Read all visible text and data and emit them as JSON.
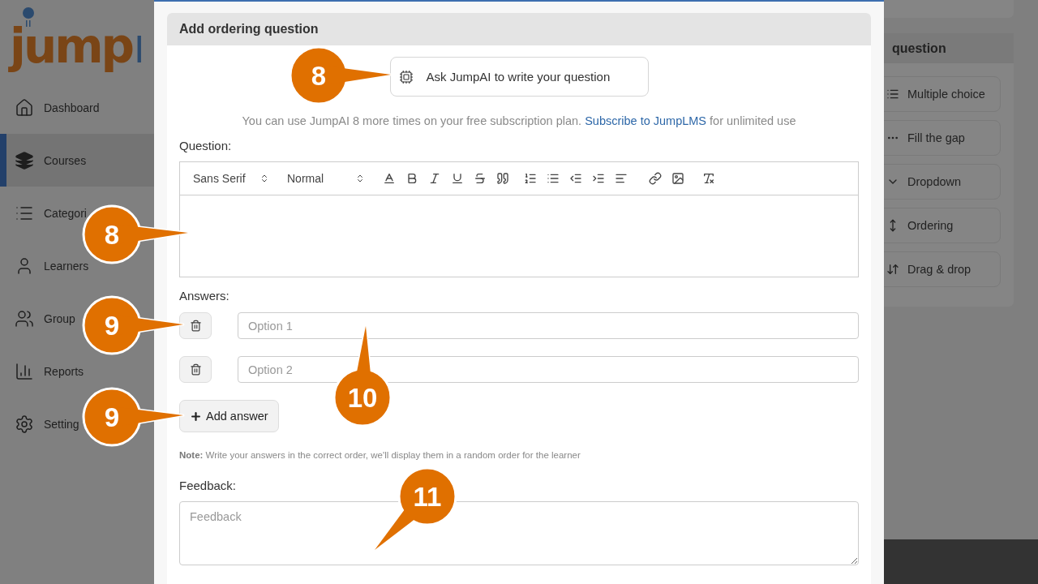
{
  "logo": {
    "text": "jump",
    "cut_text": "I"
  },
  "sidebar": {
    "items": [
      {
        "label": "Dashboard",
        "selected": false
      },
      {
        "label": "Courses",
        "selected": true
      },
      {
        "label": "Categori",
        "selected": false
      },
      {
        "label": "Learners",
        "selected": false
      },
      {
        "label": "Group",
        "selected": false
      },
      {
        "label": "Reports",
        "selected": false
      },
      {
        "label": "Setting",
        "selected": false
      }
    ]
  },
  "modal": {
    "title": "Add ordering question",
    "ai_button": "Ask JumpAI to write your question",
    "usage_note": {
      "text": "You can use JumpAI 8 more times on your free subscription plan.",
      "link": "Subscribe to JumpLMS",
      "suffix": "for unlimited use"
    },
    "question_label": "Question:",
    "toolbar": {
      "font": "Sans Serif",
      "size": "Normal"
    },
    "answers_label": "Answers:",
    "answers": [
      {
        "placeholder": "Option 1"
      },
      {
        "placeholder": "Option 2"
      }
    ],
    "add_answer": "Add answer",
    "note": "**Note:** Write your answers in the correct order, we'll display them in a random order for the learner",
    "feedback_label": "Feedback:",
    "feedback_placeholder": "Feedback"
  },
  "question_types": {
    "title": "question",
    "items": [
      {
        "label": "Multiple choice"
      },
      {
        "label": "Fill the gap"
      },
      {
        "label": "Dropdown"
      },
      {
        "label": "Ordering"
      },
      {
        "label": "Drag & drop"
      }
    ]
  },
  "callouts": [
    {
      "label": "8"
    },
    {
      "label": "8"
    },
    {
      "label": "9"
    },
    {
      "label": "9"
    },
    {
      "label": "10"
    },
    {
      "label": "11"
    }
  ]
}
